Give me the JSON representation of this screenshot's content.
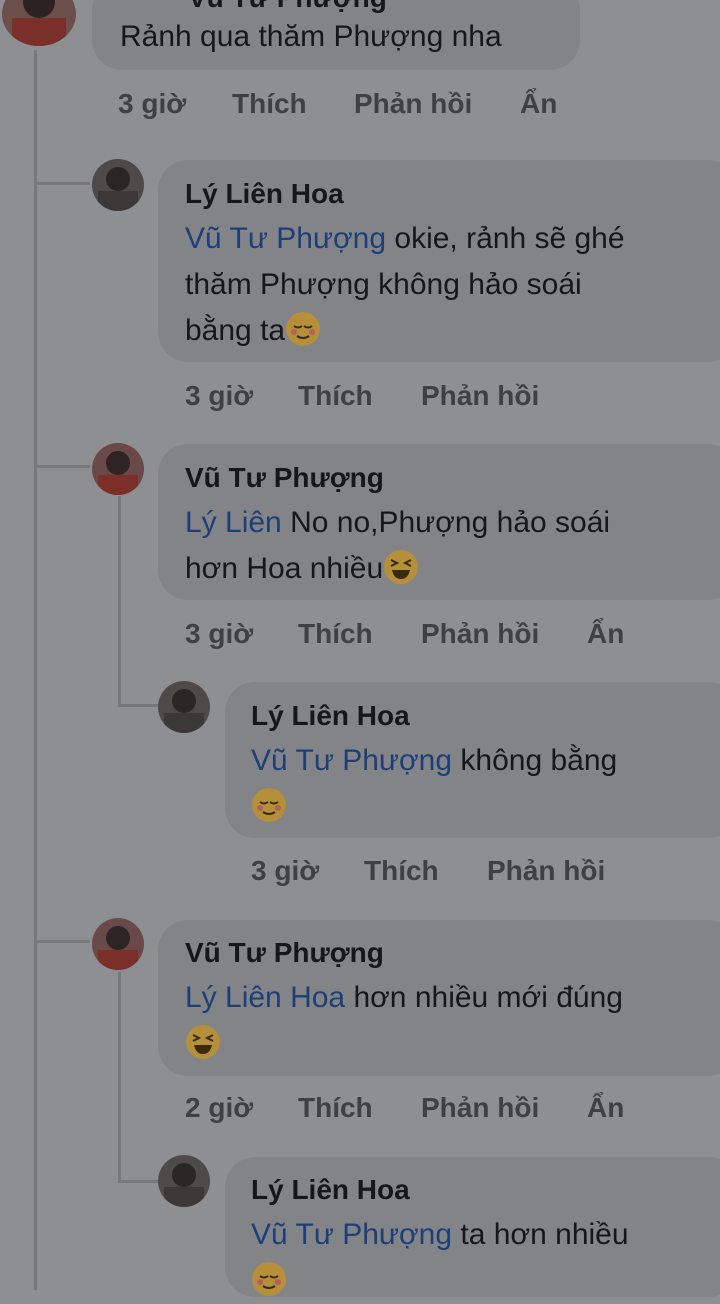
{
  "top_comment": {
    "author_partial": "Vũ Tư Phượng",
    "text": "Rảnh qua thăm Phượng nha",
    "time": "3 giờ",
    "like": "Thích",
    "reply": "Phản hồi",
    "hide": "Ẩn"
  },
  "replies": [
    {
      "author": "Lý Liên Hoa",
      "mention": "Vũ Tư Phượng",
      "text_line1": " okie, rảnh sẽ ghé",
      "text_line2": "thăm Phượng không hảo soái",
      "text_line3": "bằng ta",
      "emoji": "relieved-face",
      "time": "3 giờ",
      "like": "Thích",
      "reply": "Phản hồi"
    },
    {
      "author": "Vũ Tư Phượng",
      "mention": "Lý Liên",
      "text_line1": " No no,Phượng hảo soái",
      "text_line2": "hơn Hoa nhiều",
      "emoji": "laughing-face",
      "time": "3 giờ",
      "like": "Thích",
      "reply": "Phản hồi",
      "hide": "Ẩn"
    },
    {
      "author": "Lý Liên Hoa",
      "mention": "Vũ Tư Phượng",
      "text_line1": " không bằng",
      "emoji": "relieved-face",
      "time": "3 giờ",
      "like": "Thích",
      "reply": "Phản hồi"
    },
    {
      "author": "Vũ Tư Phượng",
      "mention": "Lý Liên Hoa",
      "text_line1": " hơn nhiều mới đúng",
      "emoji": "laughing-face",
      "time": "2 giờ",
      "like": "Thích",
      "reply": "Phản hồi",
      "hide": "Ẩn"
    },
    {
      "author": "Lý Liên Hoa",
      "mention": "Vũ Tư Phượng",
      "text_line1": " ta hơn nhiều",
      "emoji": "relieved-face"
    }
  ]
}
